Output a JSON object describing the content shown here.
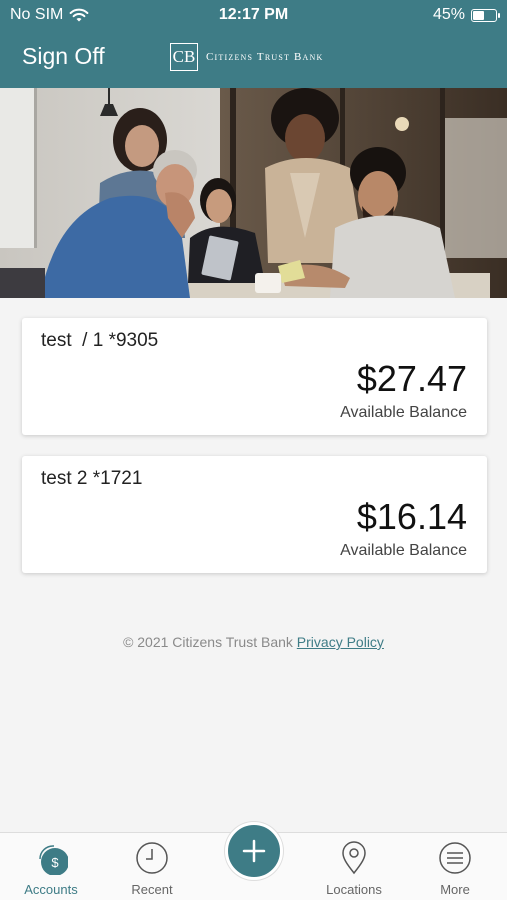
{
  "status_bar": {
    "carrier": "No SIM",
    "time": "12:17 PM",
    "battery_percent": "45%",
    "battery_level": 0.45,
    "icons": [
      "wifi-icon",
      "battery-icon"
    ]
  },
  "header": {
    "sign_off_label": "Sign Off",
    "brand_name": "Citizens Trust Bank",
    "brand_logo_letters": "CB"
  },
  "accounts": [
    {
      "name": "test  / 1 *9305",
      "balance": "$27.47",
      "balance_label": "Available Balance"
    },
    {
      "name": "test 2 *1721",
      "balance": "$16.14",
      "balance_label": "Available Balance"
    }
  ],
  "footer": {
    "copyright": "© 2021 Citizens Trust Bank ",
    "privacy_label": "Privacy Policy"
  },
  "tabbar": {
    "items": [
      {
        "label": "Accounts",
        "icon": "dollar-circle-icon",
        "active": true
      },
      {
        "label": "Recent",
        "icon": "clock-icon"
      },
      {
        "label": "Locations",
        "icon": "map-pin-icon"
      },
      {
        "label": "More",
        "icon": "menu-icon"
      }
    ],
    "center_action_icon": "plus-icon"
  },
  "colors": {
    "brand": "#3e7c86",
    "background": "#f4f4f4"
  }
}
